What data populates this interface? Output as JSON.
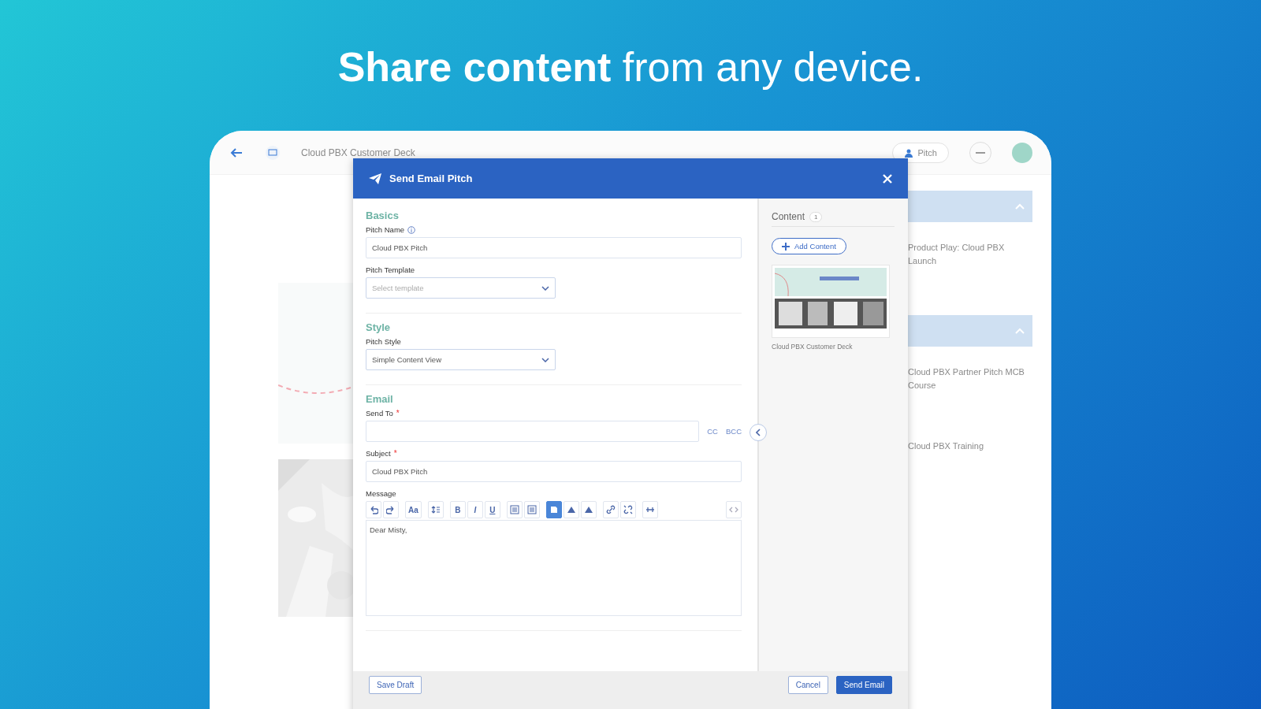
{
  "headline": "**Share content** from any device.",
  "app": {
    "title": "Cloud PBX Customer Deck",
    "pitch_button": "Pitch",
    "right_panel": {
      "items": [
        {
          "kind": "band"
        },
        {
          "kind": "item",
          "title": "Product Play: Cloud PBX Launch"
        },
        {
          "kind": "band"
        },
        {
          "kind": "item",
          "title": "Cloud PBX Partner Pitch MCB Course"
        },
        {
          "kind": "item",
          "title": "Cloud PBX Training"
        }
      ]
    }
  },
  "dialog": {
    "title": "Send Email Pitch",
    "sections": [
      {
        "heading": "Basics",
        "fields": [
          {
            "kind": "text",
            "label": "Pitch Name",
            "info": true,
            "value": "Cloud PBX Pitch"
          },
          {
            "kind": "select",
            "label": "Pitch Template",
            "info": false,
            "placeholder": "Select template"
          }
        ]
      },
      {
        "heading": "Style",
        "fields": [
          {
            "kind": "select",
            "label": "Pitch Style",
            "info": false,
            "value": "Simple Content View"
          }
        ]
      },
      {
        "heading": "Email",
        "fields": [
          {
            "kind": "recipients",
            "label": "Send To",
            "info": false,
            "required_mark": "*",
            "links": [
              "CC",
              "BCC"
            ]
          },
          {
            "kind": "text",
            "label": "Subject",
            "info": false,
            "required_mark": "*",
            "value": "Cloud PBX Pitch"
          },
          {
            "kind": "editor",
            "label": "Message",
            "info": false,
            "value": "Dear Misty,"
          }
        ]
      }
    ],
    "toolbar": [
      {
        "kind": "undo",
        "selected": false
      },
      {
        "kind": "redo",
        "selected": false
      },
      {
        "kind": "font",
        "label": "Aa",
        "selected": false
      },
      {
        "kind": "lineheight",
        "selected": false
      },
      {
        "kind": "bold",
        "label": "B",
        "selected": false
      },
      {
        "kind": "italic",
        "label": "I",
        "selected": false
      },
      {
        "kind": "underline",
        "label": "U",
        "selected": false
      },
      {
        "kind": "list",
        "selected": false
      },
      {
        "kind": "list",
        "selected": false
      },
      {
        "kind": "fill",
        "selected": true
      },
      {
        "kind": "triangle",
        "selected": false
      },
      {
        "kind": "triangle",
        "selected": false
      },
      {
        "kind": "link",
        "selected": false
      },
      {
        "kind": "unlink",
        "selected": false
      },
      {
        "kind": "rule",
        "selected": false
      },
      {
        "kind": "code",
        "selected": false
      }
    ],
    "content": {
      "heading": "Content",
      "count": "1",
      "add_button": "Add Content",
      "items": [
        {
          "kind": "picture",
          "caption": "Cloud PBX Customer Deck"
        }
      ]
    },
    "footer": {
      "save": "Save Draft",
      "cancel": "Cancel",
      "send": "Send Email"
    }
  }
}
